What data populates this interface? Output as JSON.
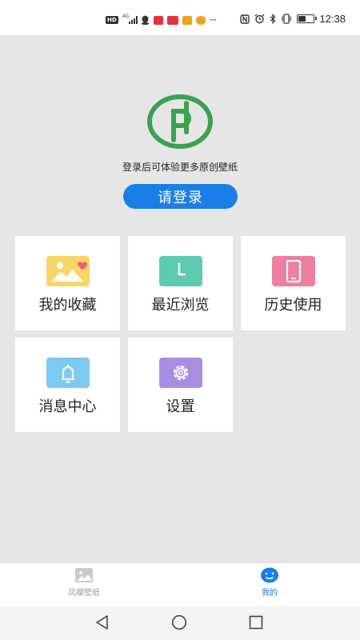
{
  "status_bar": {
    "network": "4G",
    "hd_label": "HD",
    "time": "12:38",
    "battery_level": 0.55,
    "icons": [
      "hd-icon",
      "signal-icon",
      "qq-icon",
      "mail-icon",
      "wallet-icon",
      "news-icon",
      "chat-icon",
      "more-dots-icon",
      "nfc-icon",
      "alarm-icon",
      "bluetooth-icon",
      "vibrate-icon",
      "battery-icon"
    ]
  },
  "header": {
    "tagline": "登录后可体验更多原创壁纸",
    "login_button": "请登录",
    "logo_color": "#3aa351"
  },
  "menu": [
    {
      "label": "我的收藏",
      "icon": "image-heart-icon",
      "color": "#f7d668"
    },
    {
      "label": "最近浏览",
      "icon": "clock-icon",
      "color": "#5ccbb1"
    },
    {
      "label": "历史使用",
      "icon": "phone-icon",
      "color": "#ee7fa1"
    },
    {
      "label": "消息中心",
      "icon": "bell-icon",
      "color": "#7cc9f1"
    },
    {
      "label": "设置",
      "icon": "gear-icon",
      "color": "#a78ee3"
    }
  ],
  "bottom_nav": {
    "items": [
      {
        "label": "凤蝶壁纸",
        "icon": "image-icon",
        "active": false
      },
      {
        "label": "我的",
        "icon": "smiley-icon",
        "active": true
      }
    ],
    "active_color": "#1a7ee8",
    "inactive_color": "#9a9a9a"
  },
  "system_nav": [
    "back-icon",
    "home-icon",
    "recents-icon"
  ]
}
